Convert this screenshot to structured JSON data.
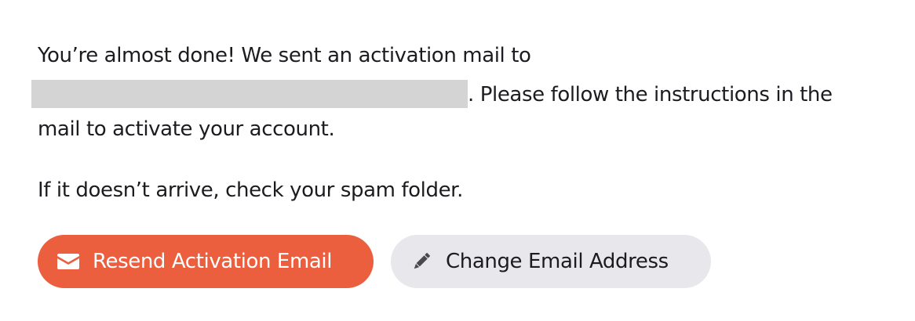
{
  "message": {
    "line1": "You’re almost done! We sent an activation mail to",
    "line2_suffix": ". Please follow the instructions in the",
    "line3": "mail to activate your account.",
    "spam_note": "If it doesn’t arrive, check your spam folder."
  },
  "buttons": {
    "resend_label": "Resend Activation Email",
    "resend_icon": "envelope-icon",
    "change_label": "Change Email Address",
    "change_icon": "pencil-icon"
  },
  "colors": {
    "primary": "#ec5f3e",
    "secondary": "#e8e7ec",
    "redaction": "#d4d4d4",
    "text": "#1c1b1f"
  }
}
